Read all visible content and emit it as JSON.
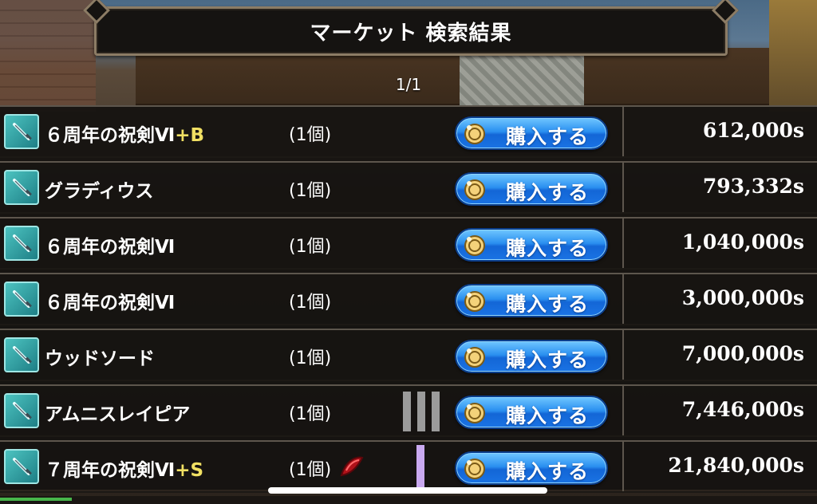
{
  "header": {
    "title": "マーケット 検索結果",
    "page_indicator": "1/1"
  },
  "buy_label": "購入する",
  "items": [
    {
      "name": "６周年の祝剣Ⅵ",
      "suffix": "+B",
      "qty": "(1個)",
      "price": "612,000s",
      "extra": ""
    },
    {
      "name": "グラディウス",
      "suffix": "",
      "qty": "(1個)",
      "price": "793,332s",
      "extra": ""
    },
    {
      "name": "６周年の祝剣Ⅵ",
      "suffix": "",
      "qty": "(1個)",
      "price": "1,040,000s",
      "extra": ""
    },
    {
      "name": "６周年の祝剣Ⅵ",
      "suffix": "",
      "qty": "(1個)",
      "price": "3,000,000s",
      "extra": ""
    },
    {
      "name": "ウッドソード",
      "suffix": "",
      "qty": "(1個)",
      "price": "7,000,000s",
      "extra": ""
    },
    {
      "name": "アムニスレイピア",
      "suffix": "",
      "qty": "(1個)",
      "price": "7,446,000s",
      "extra": "grey-bars"
    },
    {
      "name": "７周年の祝剣Ⅵ",
      "suffix": "+S",
      "qty": "(1個)",
      "price": "21,840,000s",
      "extra": "red-gem-purple-bar"
    }
  ],
  "icons": {
    "item": "sword-icon",
    "buy": "coin-icon"
  },
  "colors": {
    "buy_button": "#2a8ff0",
    "suffix": "#f1e063",
    "item_icon": "#4cc3c0"
  }
}
